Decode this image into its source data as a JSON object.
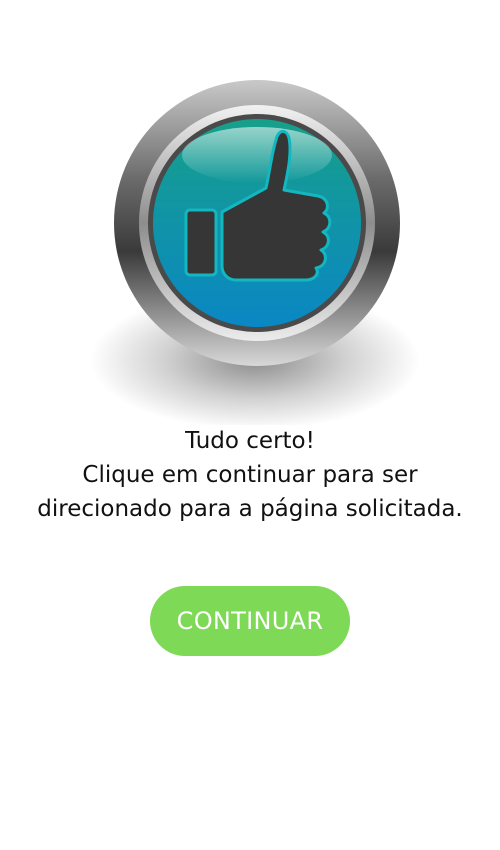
{
  "hero": {
    "icon": "thumbs-up-icon",
    "colors": {
      "disc_top": "#16a08a",
      "disc_bottom": "#0a87c4",
      "hand": "#363636",
      "hand_outline": "#13b7c0"
    }
  },
  "message": {
    "line1": "Tudo certo!",
    "line2": "Clique em continuar para ser",
    "line3": "direcionado para a página solicitada."
  },
  "button": {
    "label": "CONTINUAR",
    "color": "#7ed957"
  }
}
